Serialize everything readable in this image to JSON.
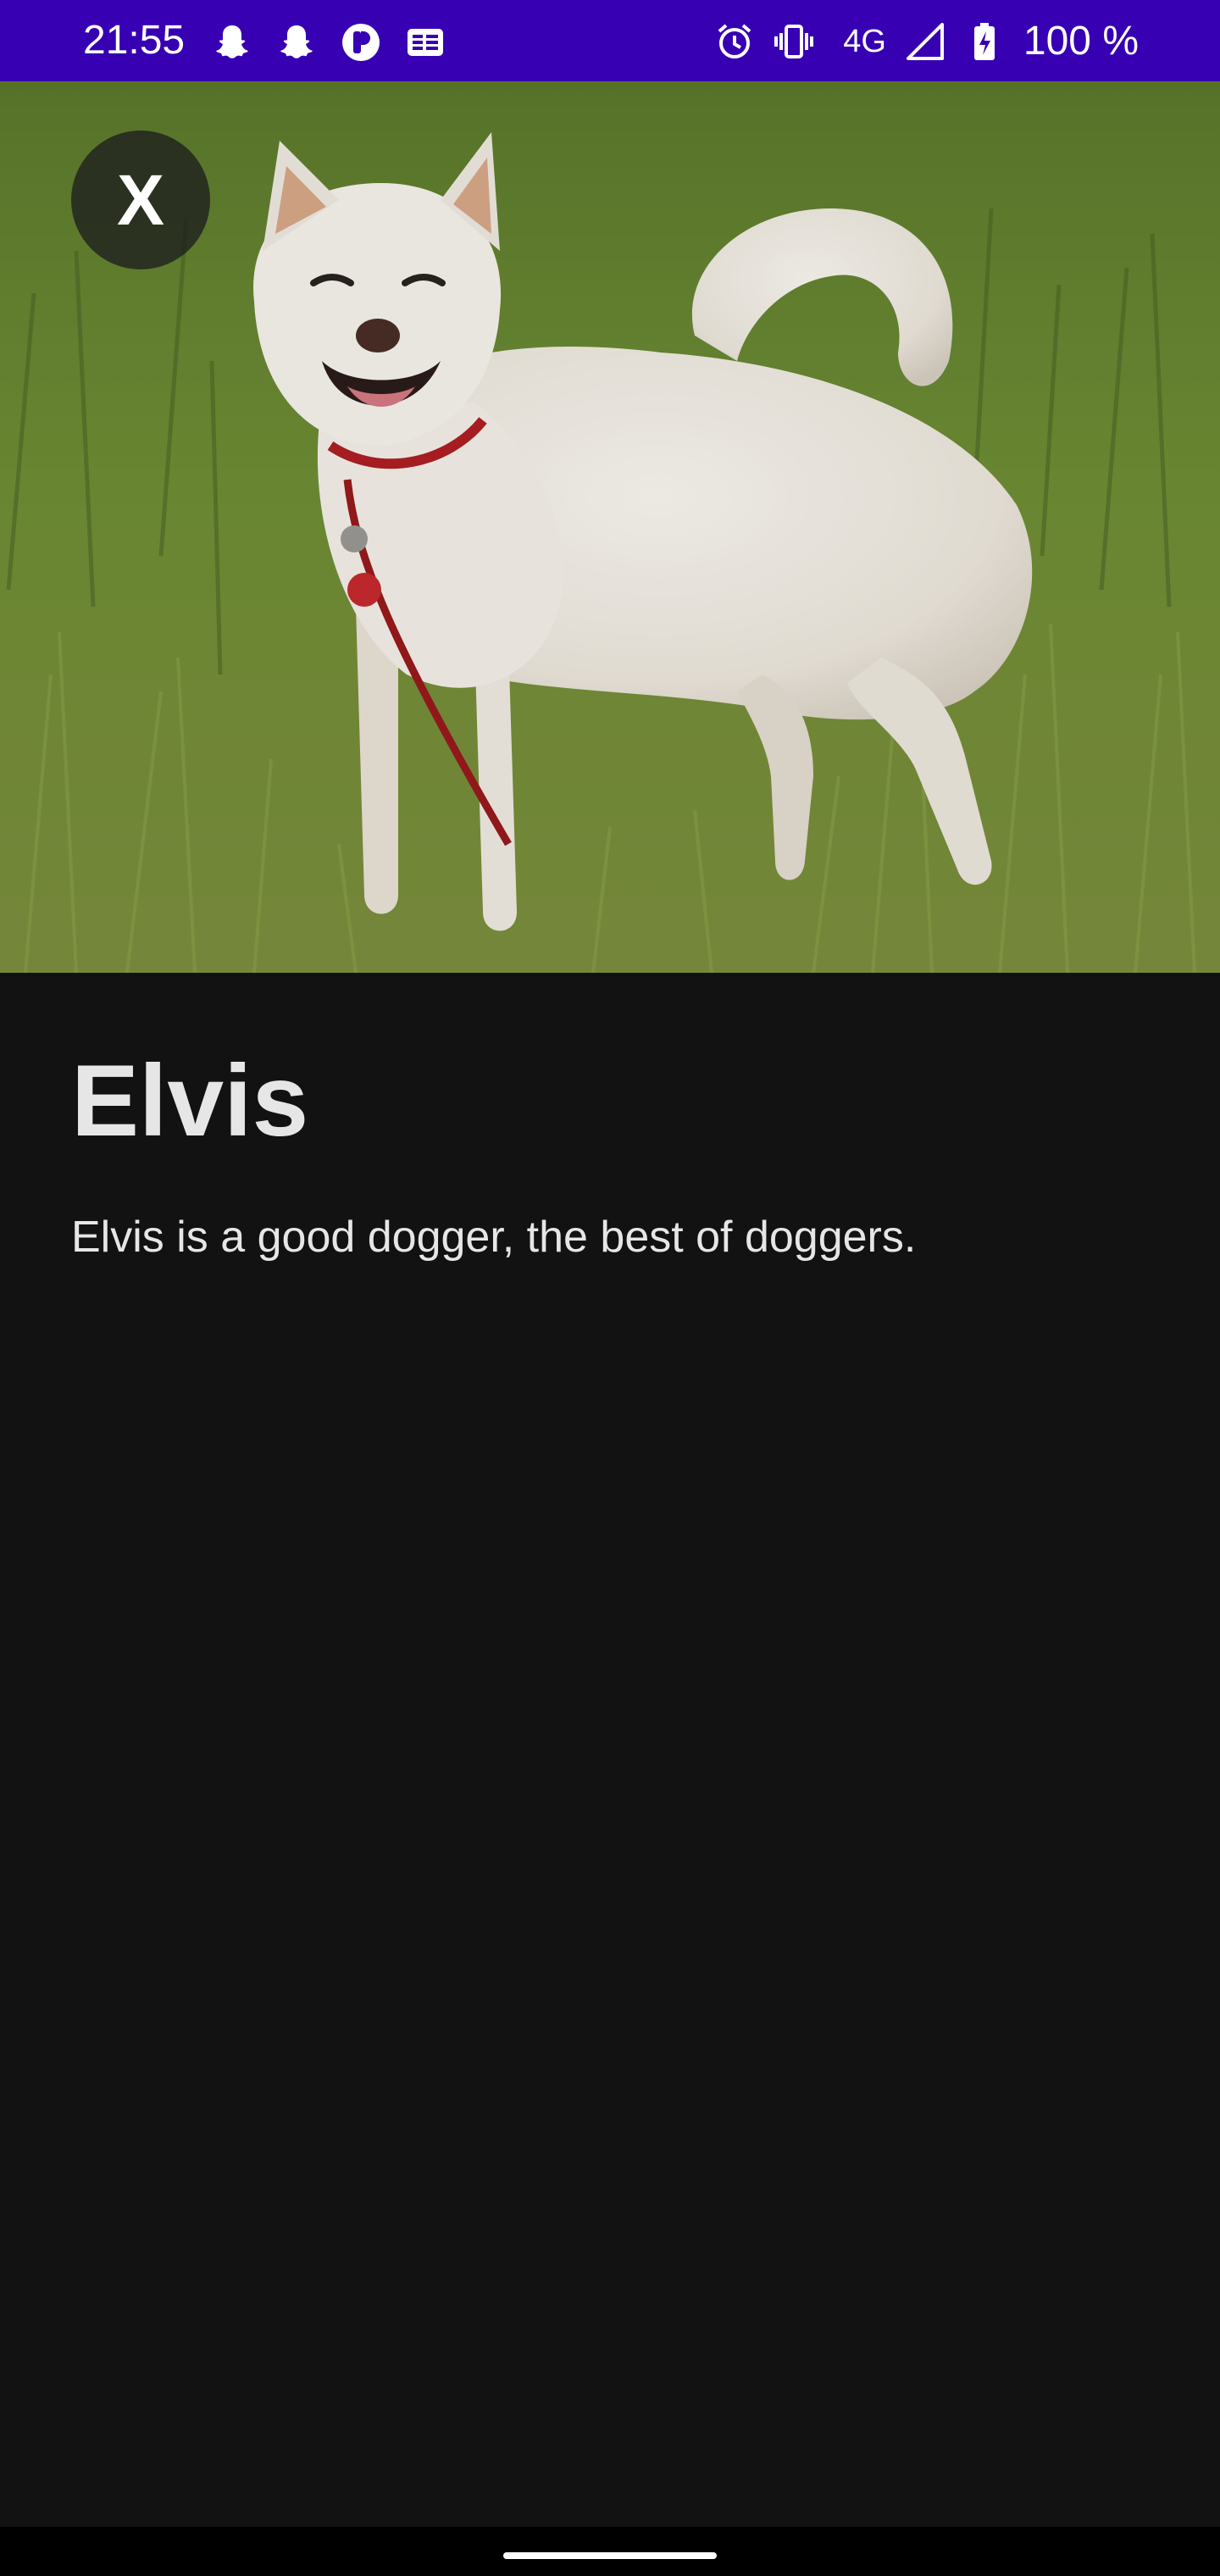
{
  "status_bar": {
    "time": "21:55",
    "network": "4G",
    "battery": "100 %",
    "background": "#3700b3",
    "notification_icons": [
      "snapchat-icon",
      "snapchat-icon",
      "app-icon",
      "news-icon"
    ],
    "system_icons": [
      "alarm-icon",
      "vibrate-icon",
      "signal-icon",
      "battery-charging-icon"
    ]
  },
  "hero": {
    "image": "white dog standing in grass",
    "close_label": "X"
  },
  "dog": {
    "name": "Elvis",
    "description": "Elvis is a good dogger, the best of doggers."
  },
  "colors": {
    "background": "#121212",
    "text": "#e6e6e6",
    "status_bar": "#3700b3"
  }
}
